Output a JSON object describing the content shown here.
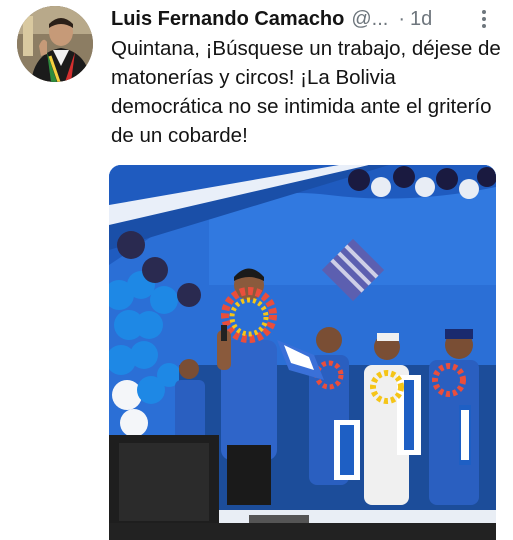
{
  "tweet": {
    "author_name": "Luis Fernando Camacho",
    "handle": "@...",
    "separator": "·",
    "time": "1d",
    "text": "Quintana, ¡Búsquese un trabajo, déjese de matonerías y circos! ¡La Bolivia democrática no se intimida ante el griterío de un cobarde!",
    "avatar_icon": "profile-photo",
    "more_icon": "vertical-ellipsis-icon",
    "media_icon": "video-thumbnail"
  },
  "colors": {
    "text": "#141414",
    "muted": "#6e767d",
    "stage_blue": "#2a6fd8",
    "balloon_blue": "#1e88e5"
  }
}
